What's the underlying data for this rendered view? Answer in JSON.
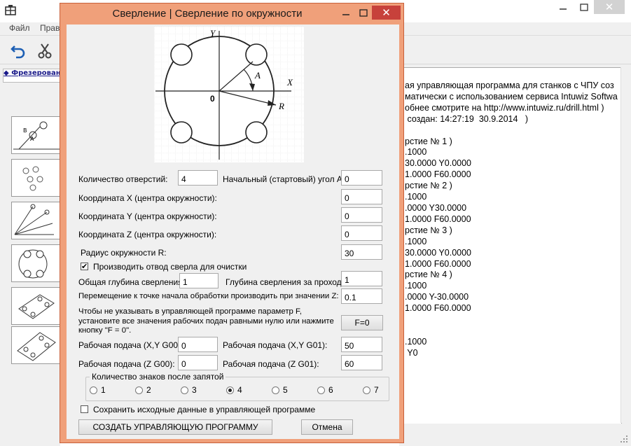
{
  "main_window": {
    "menu": [
      "Файл",
      "Прав"
    ],
    "left_tab_label": "Фрезерован",
    "code_lines": [
      "ая управляющая программа для станков с ЧПУ соз",
      "матически с использованием сервиса Intuwiz Softwa",
      "обнее смотрите на http://www.intuwiz.ru/drill.html )",
      " создан: 14:27:19  30.9.2014   )",
      "",
      "рстие № 1 )",
      ".1000",
      "30.0000 Y0.0000",
      "1.0000 F60.0000",
      "рстие № 2 )",
      ".1000",
      ".0000 Y30.0000",
      "1.0000 F60.0000",
      "рстие № 3 )",
      ".1000",
      "30.0000 Y0.0000",
      "1.0000 F60.0000",
      "рстие № 4 )",
      ".1000",
      ".0000 Y-30.0000",
      "1.0000 F60.0000",
      "",
      "",
      ".1000",
      " Y0"
    ]
  },
  "dialog": {
    "title": "Сверление | Сверление по окружности",
    "diagram": {
      "y": "Y",
      "x": "X",
      "a": "A",
      "r": "R",
      "origin": "0"
    },
    "holes_count_label": "Количество отверстий:",
    "holes_count": "4",
    "start_angle_label": "Начальный (стартовый) угол A:",
    "start_angle": "0",
    "coord_x_label": "Координата X (центра окружности):",
    "coord_x": "0",
    "coord_y_label": "Координата Y (центра окружности):",
    "coord_y": "0",
    "coord_z_label": "Координата Z (центра окружности):",
    "coord_z": "0",
    "radius_label": "Радиус окружности R:",
    "radius": "30",
    "retract_label": "Производить отвод сверла для очистки",
    "retract_checked": true,
    "total_depth_label": "Общая глубина сверления:",
    "total_depth": "1",
    "pass_depth_label": "Глубина сверления за проход:",
    "pass_depth": "1",
    "move_label": "Перемещение к точке начала обработки производить при значении Z:",
    "move_z": "0.1",
    "feed_note_1": "Чтобы не указывать в управляющей программе параметр F,",
    "feed_note_2": "установите все значения рабочих подач равными нулю или нажмите",
    "feed_note_3": "кнопку \"F = 0\".",
    "f0_button": "F=0",
    "feed_xy_g00_label": "Рабочая подача (X,Y G00):",
    "feed_xy_g00": "0",
    "feed_xy_g01_label": "Рабочая подача (X,Y G01):",
    "feed_xy_g01": "50",
    "feed_z_g00_label": "Рабочая подача (Z G00):",
    "feed_z_g00": "0",
    "feed_z_g01_label": "Рабочая подача (Z G01):",
    "feed_z_g01": "60",
    "decimals_label": "Количество знаков после запятой",
    "decimals_options": [
      "1",
      "2",
      "3",
      "4",
      "5",
      "6",
      "7"
    ],
    "decimals_selected": "4",
    "save_label": "Сохранить исходные данные в управляющей программе",
    "save_checked": false,
    "create_button": "СОЗДАТЬ УПРАВЛЯЮЩУЮ ПРОГРАММУ",
    "cancel_button": "Отмена"
  },
  "colors": {
    "dialog_frame": "#f0a07a",
    "close_button": "#c7413b"
  }
}
